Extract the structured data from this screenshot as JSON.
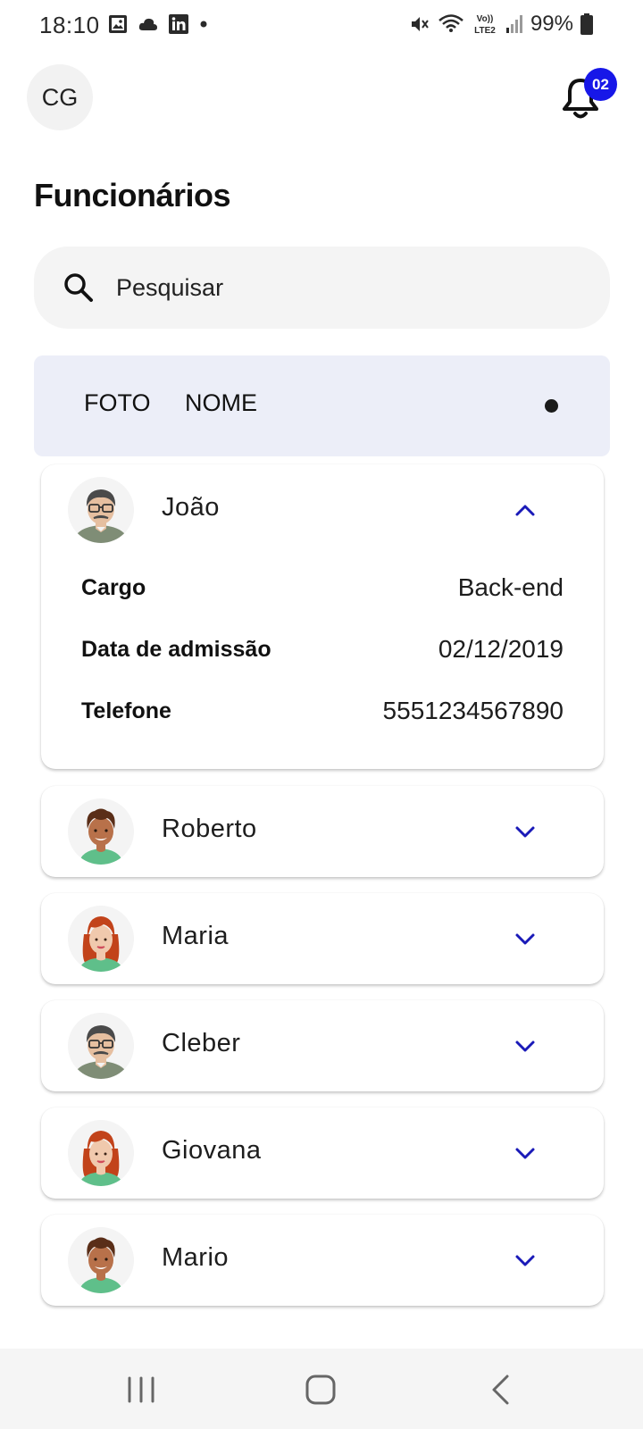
{
  "status_bar": {
    "time": "18:10",
    "battery_text": "99%",
    "left_icons": [
      "image-icon",
      "cloud-icon",
      "linkedin-icon",
      "dot-icon"
    ],
    "right_icons": [
      "mute-icon",
      "wifi-icon",
      "volte-icon",
      "signal-icon",
      "battery-icon"
    ],
    "volte_label": "Vo)) LTE2"
  },
  "header": {
    "avatar_initials": "CG",
    "notification_count": "02"
  },
  "page": {
    "title": "Funcionários"
  },
  "search": {
    "placeholder": "Pesquisar"
  },
  "table_header": {
    "photo_label": "FOTO",
    "name_label": "NOME"
  },
  "employees": [
    {
      "name": "João",
      "avatar": "older-man-glasses",
      "expanded": true,
      "details": [
        {
          "label": "Cargo",
          "value": "Back-end"
        },
        {
          "label": "Data de admissão",
          "value": "02/12/2019"
        },
        {
          "label": "Telefone",
          "value": "5551234567890"
        }
      ]
    },
    {
      "name": "Roberto",
      "avatar": "young-man-curly",
      "expanded": false
    },
    {
      "name": "Maria",
      "avatar": "woman-redhead",
      "expanded": false
    },
    {
      "name": "Cleber",
      "avatar": "older-man-glasses",
      "expanded": false
    },
    {
      "name": "Giovana",
      "avatar": "woman-redhead",
      "expanded": false
    },
    {
      "name": "Mario",
      "avatar": "young-man-curly",
      "expanded": false
    }
  ],
  "colors": {
    "accent": "#1717e8",
    "chevron": "#1a1ab8",
    "table_header_bg": "#eceef8",
    "search_bg": "#f4f4f4"
  },
  "navigation": {
    "buttons": [
      "recents-icon",
      "home-icon",
      "back-icon"
    ]
  }
}
